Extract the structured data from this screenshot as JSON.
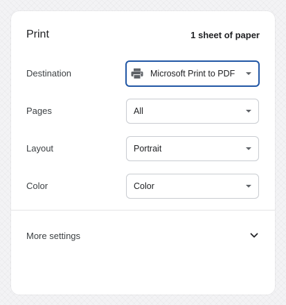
{
  "header": {
    "title": "Print",
    "sheet_count": "1 sheet of paper"
  },
  "fields": {
    "destination": {
      "label": "Destination",
      "value": "Microsoft Print to PDF",
      "icon": "printer-icon"
    },
    "pages": {
      "label": "Pages",
      "value": "All"
    },
    "layout": {
      "label": "Layout",
      "value": "Portrait"
    },
    "color": {
      "label": "Color",
      "value": "Color"
    }
  },
  "more_settings": {
    "label": "More settings",
    "icon": "chevron-down-icon"
  },
  "colors": {
    "focus_border": "#1f55a4",
    "field_border": "#c8cbd0"
  }
}
